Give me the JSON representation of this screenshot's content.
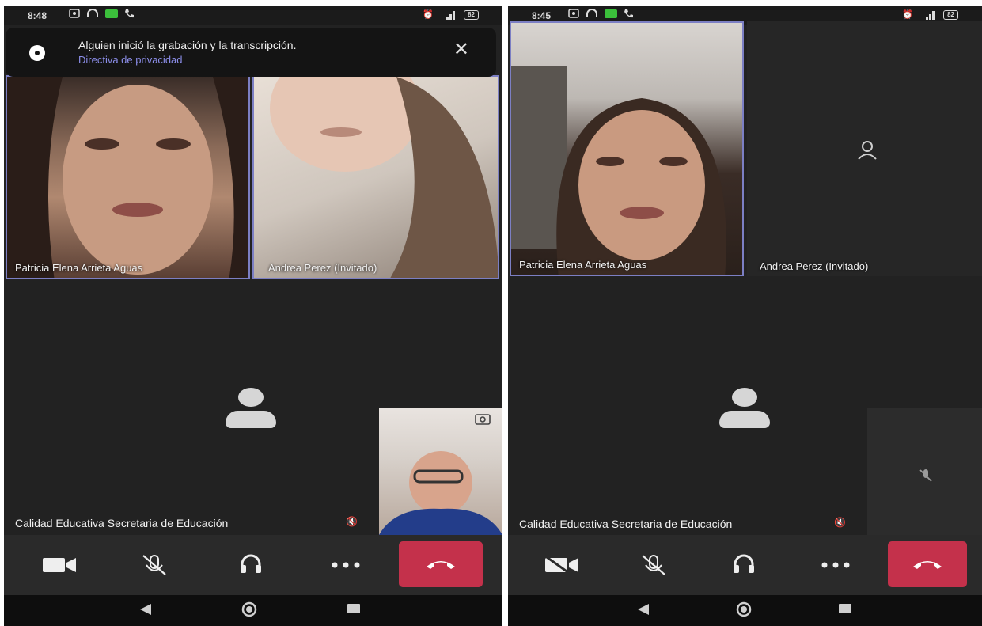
{
  "left": {
    "status": {
      "time": "8:48",
      "battery": "82"
    },
    "banner": {
      "message": "Alguien inició la grabación y la transcripción.",
      "link": "Directiva de privacidad",
      "close": "✕"
    },
    "participants": [
      {
        "name": "Patricia Elena Arrieta Aguas"
      },
      {
        "name": "Andrea Perez (Invitado)"
      }
    ],
    "main_participant": {
      "name": "Calidad Educativa Secretaria de Educación"
    }
  },
  "right": {
    "status": {
      "time": "8:45",
      "battery": "82"
    },
    "participants": [
      {
        "name": "Patricia Elena Arrieta Aguas"
      },
      {
        "name": "Andrea Perez (Invitado)"
      }
    ],
    "main_participant": {
      "name": "Calidad Educativa Secretaria de Educación"
    }
  },
  "controls": [
    "camera-icon",
    "mic-off-icon",
    "headset-icon",
    "more-icon",
    "hang-up-icon"
  ],
  "colors": {
    "accent": "#7c7fc4",
    "hangup": "#c4314b",
    "link": "#8b8de8",
    "background": "#222222"
  }
}
